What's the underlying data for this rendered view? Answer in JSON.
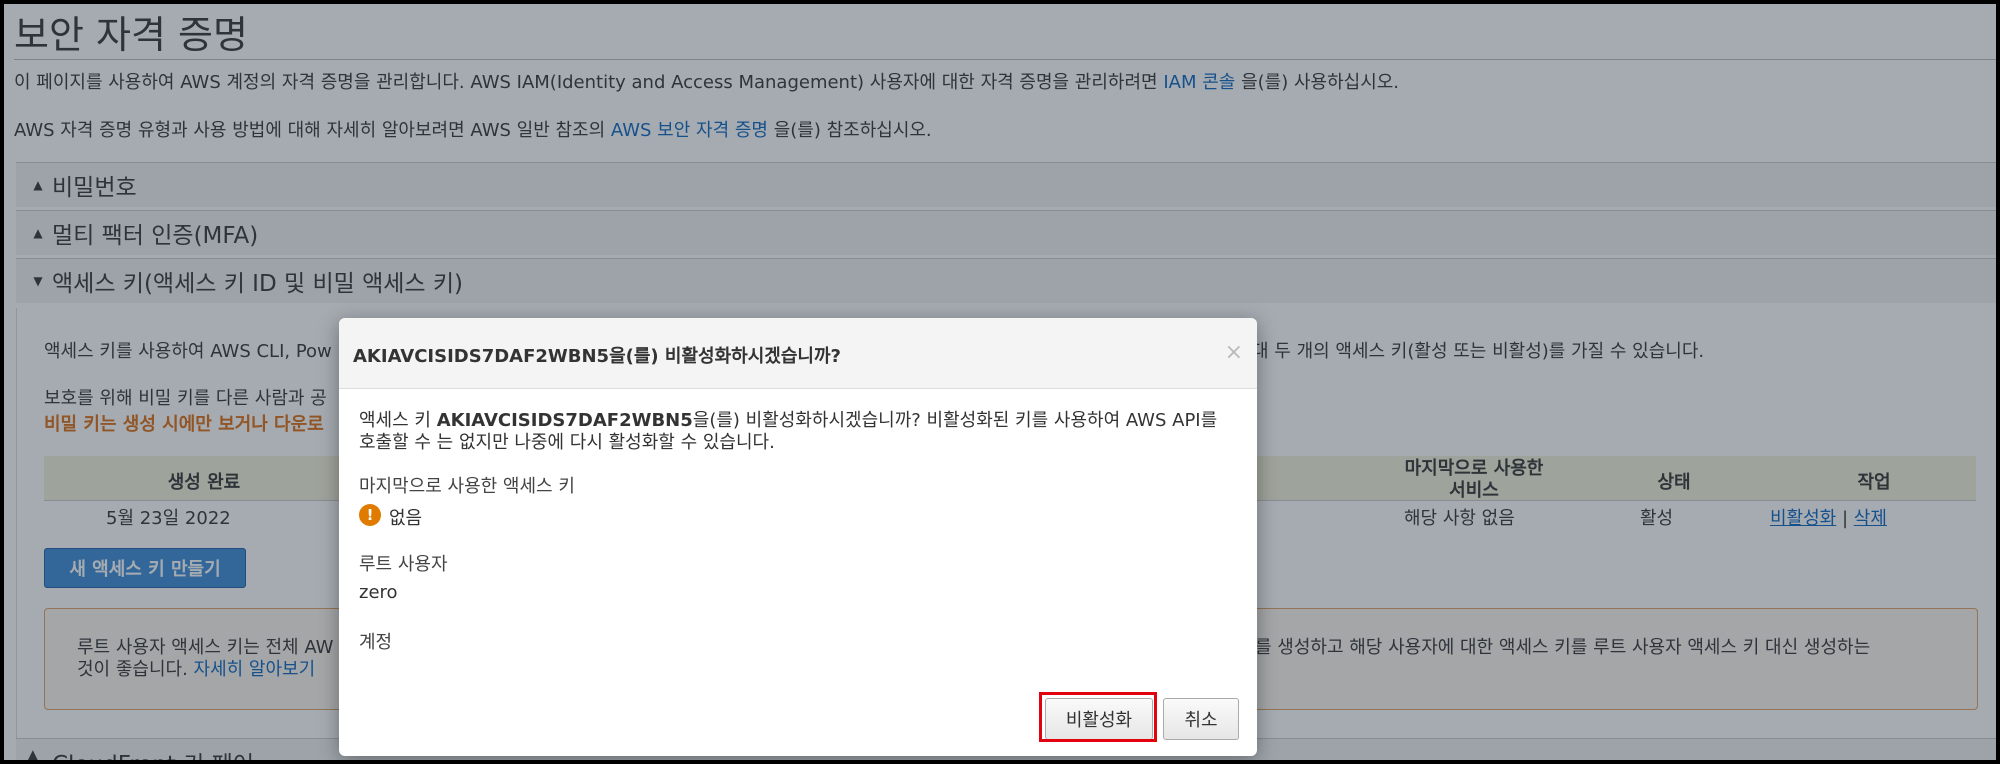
{
  "page": {
    "title": "보안 자격 증명",
    "intro1_pre": "이 페이지를 사용하여 AWS 계정의 자격 증명을 관리합니다. AWS IAM(Identity and Access Management) 사용자에 대한 자격 증명을 관리하려면 ",
    "intro1_link": "IAM 콘솔",
    "intro1_post": " 을(를) 사용하십시오.",
    "intro2_pre": "AWS 자격 증명 유형과 사용 방법에 대해 자세히 알아보려면 AWS 일반 참조의 ",
    "intro2_link": "AWS 보안 자격 증명",
    "intro2_post": " 을(를) 참조하십시오."
  },
  "sections": {
    "password": "비밀번호",
    "mfa": "멀티 팩터 인증(MFA)",
    "access_keys": "액세스 키(액세스 키 ID 및 비밀 액세스 키)",
    "cloudfront": "CloudFront 키 페어"
  },
  "access_keys": {
    "desc_left": "액세스 키를 사용하여 AWS CLI, Pow",
    "desc_right": "대 두 개의 액세스 키(활성 또는 비활성)를 가질 수 있습니다.",
    "protect_left": "보호를 위해 비밀 키를 다른 사람과 공",
    "secret_warn": "비밀 키는 생성 시에만 보거나 다운로",
    "columns": {
      "created": "생성 완료",
      "last_used_1": "마지막으로 사용한",
      "last_used_2": "서비스",
      "status": "상태",
      "actions": "작업"
    },
    "row": {
      "created": "5월 23일 2022",
      "last_used": "해당 사항 없음",
      "status": "활성",
      "deactivate": "비활성화",
      "sep": "|",
      "delete": "삭제"
    },
    "create_button": "새 액세스 키 만들기",
    "root_warn_left1": "루트 사용자 액세스 키는 전체 AW",
    "root_warn_right1": "를 생성하고 해당 사용자에 대한 액세스 키를 루트 사용자 액세스 키 대신 생성하는",
    "root_warn_left2": "것이 좋습니다. ",
    "root_warn_link": "자세히 알아보기"
  },
  "modal": {
    "title": "AKIAVCISIDS7DAF2WBN5을(를) 비활성화하시겠습니까?",
    "close": "×",
    "body1_pre": "액세스 키 ",
    "body1_key": "AKIAVCISIDS7DAF2WBN5",
    "body1_post": "을(를) 비활성화하시겠습니까? 비활성화된 키를 사용하여 AWS API를",
    "body2": "호출할 수 는 없지만 나중에 다시 활성화할 수 있습니다.",
    "last_used_label": "마지막으로 사용한 액세스 키",
    "last_used_value": "없음",
    "root_user_label": "루트 사용자",
    "root_user_value": "zero",
    "account_label": "계정",
    "deactivate_button": "비활성화",
    "cancel_button": "취소"
  },
  "colors": {
    "link": "#0b64c0",
    "warning": "#dd6b10",
    "primary_button": "#3c8ad6",
    "highlight": "#e3000f"
  }
}
